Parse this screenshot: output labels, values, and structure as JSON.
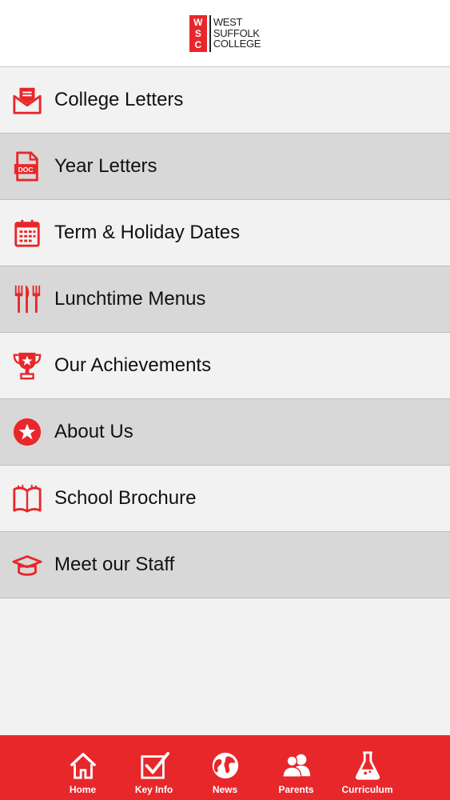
{
  "header": {
    "logo_letters": [
      "W",
      "S",
      "C"
    ],
    "logo_lines": [
      "WEST",
      "SUFFOLK",
      "COLLEGE"
    ]
  },
  "menu": {
    "items": [
      {
        "label": "College Letters",
        "icon": "envelope-icon"
      },
      {
        "label": "Year Letters",
        "icon": "document-icon"
      },
      {
        "label": "Term & Holiday Dates",
        "icon": "calendar-icon"
      },
      {
        "label": "Lunchtime Menus",
        "icon": "cutlery-icon"
      },
      {
        "label": "Our Achievements",
        "icon": "trophy-icon"
      },
      {
        "label": "About Us",
        "icon": "star-icon"
      },
      {
        "label": "School Brochure",
        "icon": "book-icon"
      },
      {
        "label": "Meet our Staff",
        "icon": "graduation-cap-icon"
      }
    ]
  },
  "tabbar": {
    "tabs": [
      {
        "label": "Home",
        "icon": "home-icon"
      },
      {
        "label": "Key Info",
        "icon": "checkbox-icon"
      },
      {
        "label": "News",
        "icon": "globe-icon"
      },
      {
        "label": "Parents",
        "icon": "users-icon"
      },
      {
        "label": "Curriculum",
        "icon": "flask-icon"
      }
    ]
  },
  "colors": {
    "accent": "#e8272b",
    "row_light": "#f2f2f2",
    "row_dark": "#d8d8d8"
  }
}
